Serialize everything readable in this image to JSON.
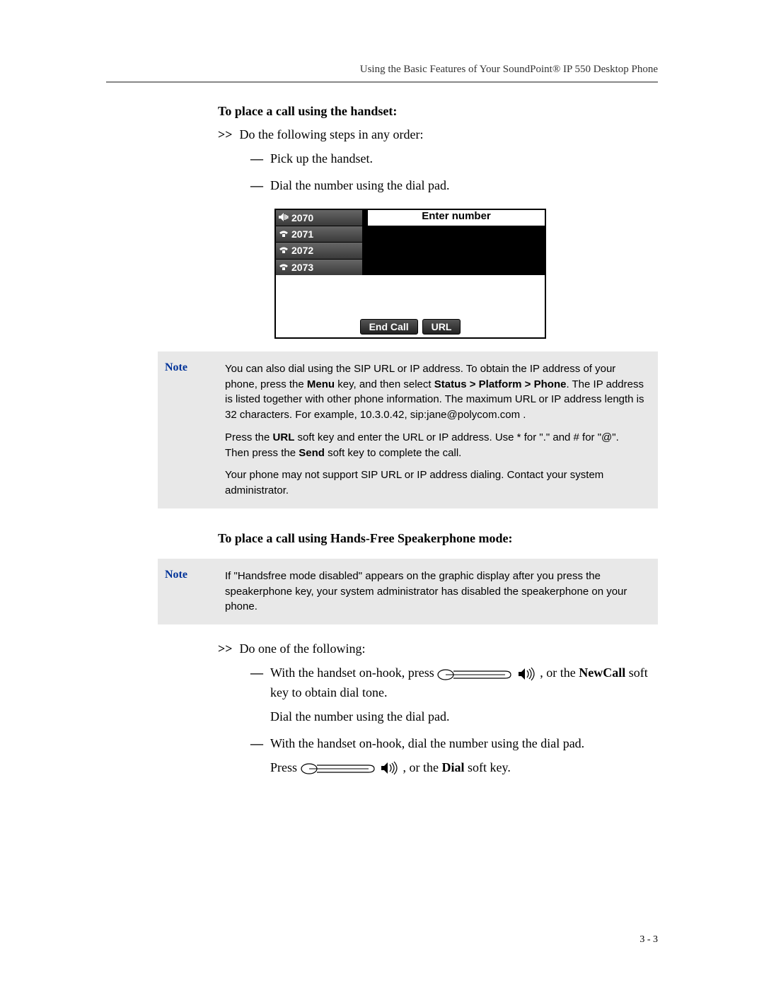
{
  "header": "Using the Basic Features of Your SoundPoint® IP 550 Desktop Phone",
  "section1": {
    "title": "To place a call using the handset:",
    "lead": "Do the following steps in any order:",
    "items": [
      "Pick up the handset.",
      "Dial the number using the dial pad."
    ]
  },
  "phone_screen": {
    "lines": [
      "2070",
      "2071",
      "2072",
      "2073"
    ],
    "prompt": "Enter number",
    "softkeys": [
      "End Call",
      "URL"
    ]
  },
  "note1": {
    "label": "Note",
    "paras": [
      "You can also dial using the SIP URL or IP address. To obtain the IP address of your phone, press the <b>Menu</b> key, and then select <b>Status &gt; Platform &gt; Phone</b>. The IP address is listed together with other phone information. The maximum URL or IP address length is 32 characters. For example, 10.3.0.42, sip:jane@polycom.com .",
      "Press the <b>URL</b> soft key and enter the URL or IP address. Use * for \".\" and # for \"@\". Then press the <b>Send</b> soft key to complete the call.",
      "Your phone may not support SIP URL or IP address dialing. Contact your system administrator."
    ]
  },
  "section2": {
    "title": "To place a call using Hands-Free Speakerphone mode:"
  },
  "note2": {
    "label": "Note",
    "paras": [
      "If \"Handsfree mode disabled\" appears on the graphic display after you press the speakerphone key, your system administrator has disabled the speakerphone on your phone."
    ]
  },
  "section3": {
    "lead": "Do one of the following:",
    "item1_a": "With the handset on-hook, press ",
    "item1_b": ", or the ",
    "item1_c": "NewCall",
    "item1_d": " soft key to obtain dial tone.",
    "item1_p2": "Dial the number using the dial pad.",
    "item2_a": "With the handset on-hook, dial the number using the dial pad.",
    "item2_b": "Press ",
    "item2_c": ", or the ",
    "item2_d": "Dial",
    "item2_e": " soft key."
  },
  "page_number": "3 - 3",
  "chevrons": ">>",
  "dash": "—",
  "comma_sep": " , "
}
